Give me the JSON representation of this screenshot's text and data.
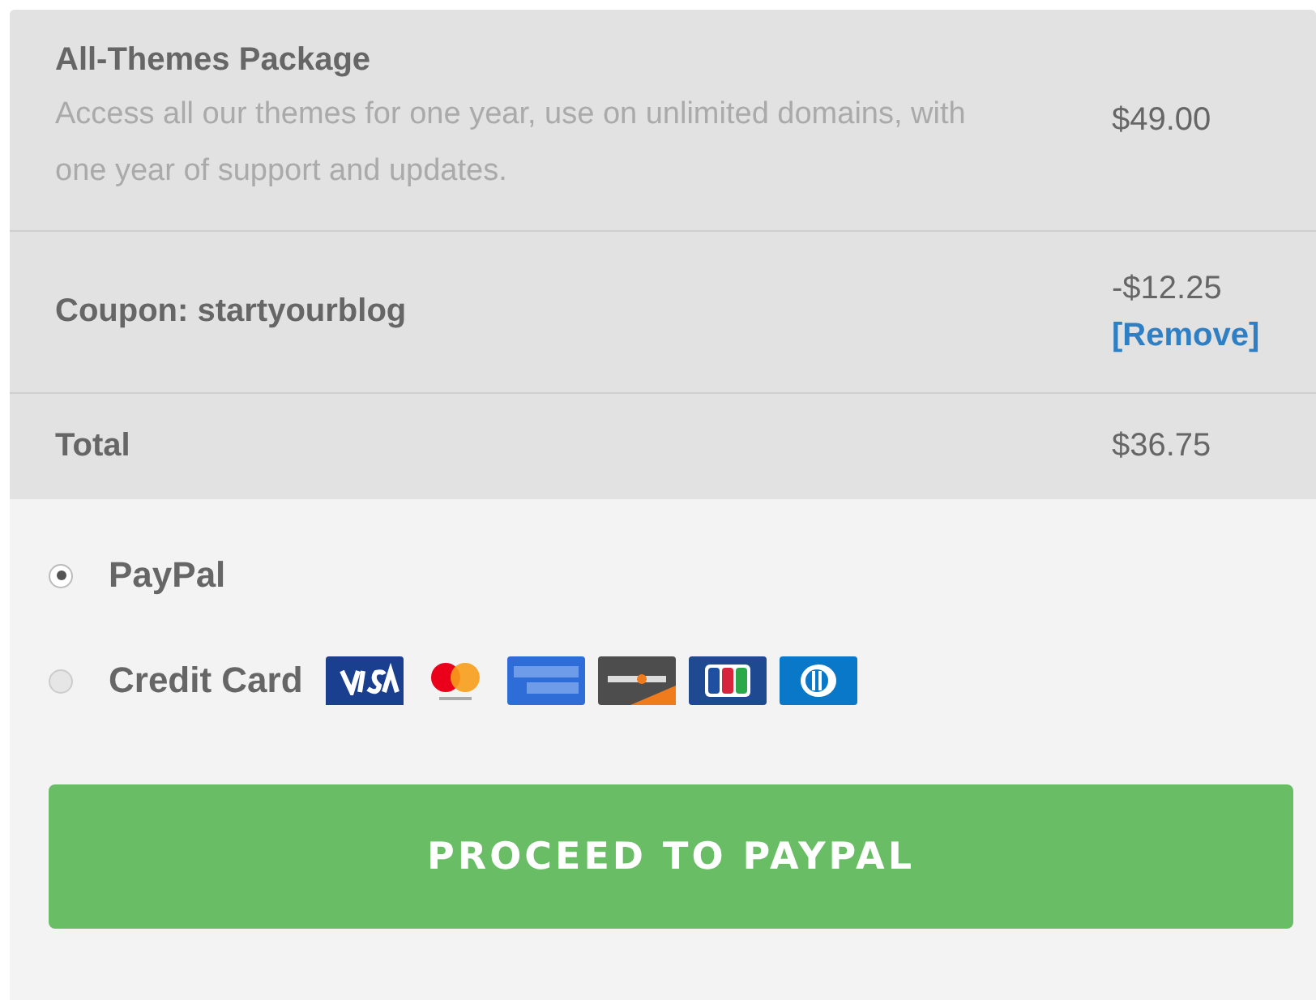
{
  "order": {
    "item": {
      "name": "All-Themes Package",
      "description": "Access all our themes for one year, use on unlimited domains, with one year of support and updates.",
      "price": "$49.00"
    },
    "coupon": {
      "label": "Coupon: startyourblog",
      "amount": "-$12.25",
      "remove_link": "[Remove]"
    },
    "total": {
      "label": "Total",
      "amount": "$36.75"
    }
  },
  "payment_methods": [
    {
      "label": "PayPal",
      "selected": true,
      "kind": "plain"
    },
    {
      "label": "Credit Card",
      "selected": false,
      "kind": "cards"
    }
  ],
  "button": "PROCEED TO PAYPAL"
}
